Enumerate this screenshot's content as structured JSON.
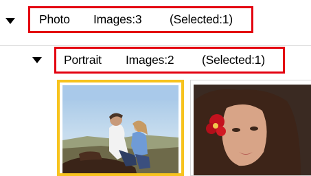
{
  "tree": {
    "photo": {
      "name": "Photo",
      "images": "Images:3",
      "selected": "(Selected:1)",
      "expanded": true
    },
    "portrait": {
      "name": "Portrait",
      "images": "Images:2",
      "selected": "(Selected:1)",
      "expanded": true
    }
  },
  "colors": {
    "highlight_border": "#e3000f",
    "selected_thumb_border": "#f7c31e"
  },
  "thumbnails": [
    {
      "name": "horse-riding-photo",
      "selected": true
    },
    {
      "name": "woman-with-flower-photo",
      "selected": false
    }
  ]
}
